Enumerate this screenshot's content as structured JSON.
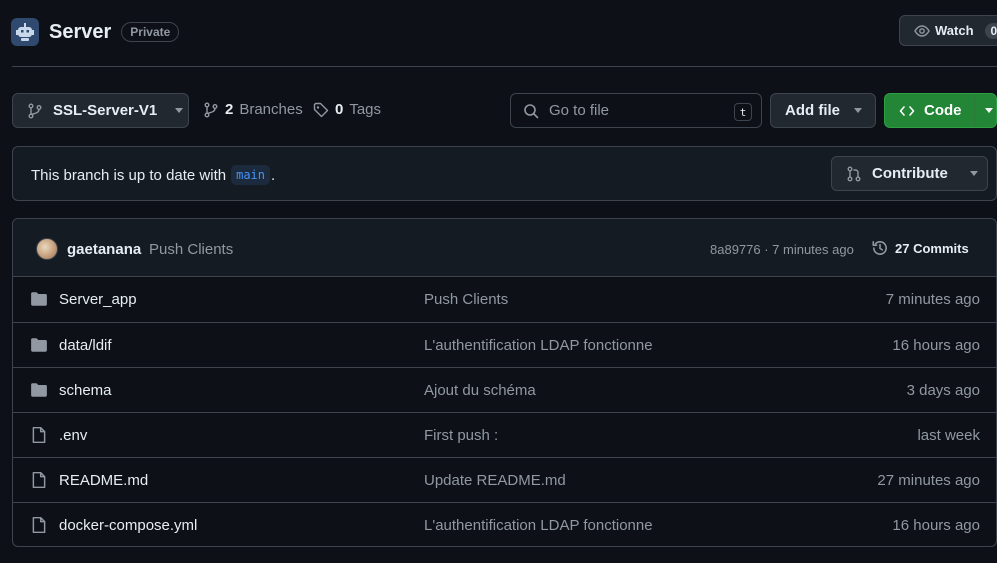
{
  "repo": {
    "name": "Server",
    "visibility": "Private",
    "avatar_icon": "repo-owner-avatar"
  },
  "watch": {
    "label": "Watch",
    "count": "0"
  },
  "toolbar": {
    "branch": "SSL-Server-V1",
    "branches_count": "2",
    "branches_label": "Branches",
    "tags_count": "0",
    "tags_label": "Tags",
    "search_placeholder": "Go to file",
    "search_shortcut": "t",
    "add_file_label": "Add file",
    "code_label": "Code"
  },
  "branch_status": {
    "text_before": "This branch is up to date with",
    "branch_ref": "main",
    "text_after": ".",
    "contribute_label": "Contribute"
  },
  "latest_commit": {
    "author": "gaetanana",
    "message": "Push Clients",
    "meta": "8a89776 · 7 minutes ago",
    "commits_label": "27 Commits"
  },
  "files": [
    {
      "type": "folder",
      "name": "Server_app",
      "message": "Push Clients",
      "time": "7 minutes ago"
    },
    {
      "type": "folder",
      "name": "data/ldif",
      "message": "L'authentification LDAP fonctionne",
      "time": "16 hours ago"
    },
    {
      "type": "folder",
      "name": "schema",
      "message": "Ajout du schéma",
      "time": "3 days ago"
    },
    {
      "type": "file",
      "name": ".env",
      "message": "First push :",
      "time": "last week"
    },
    {
      "type": "file",
      "name": "README.md",
      "message": "Update README.md",
      "time": "27 minutes ago"
    },
    {
      "type": "file",
      "name": "docker-compose.yml",
      "message": "L'authentification LDAP fonctionne",
      "time": "16 hours ago"
    }
  ],
  "colors": {
    "background": "#0d1117",
    "accent_green": "#238636",
    "link_blue": "#4493f8",
    "muted_text": "#9198a1"
  }
}
